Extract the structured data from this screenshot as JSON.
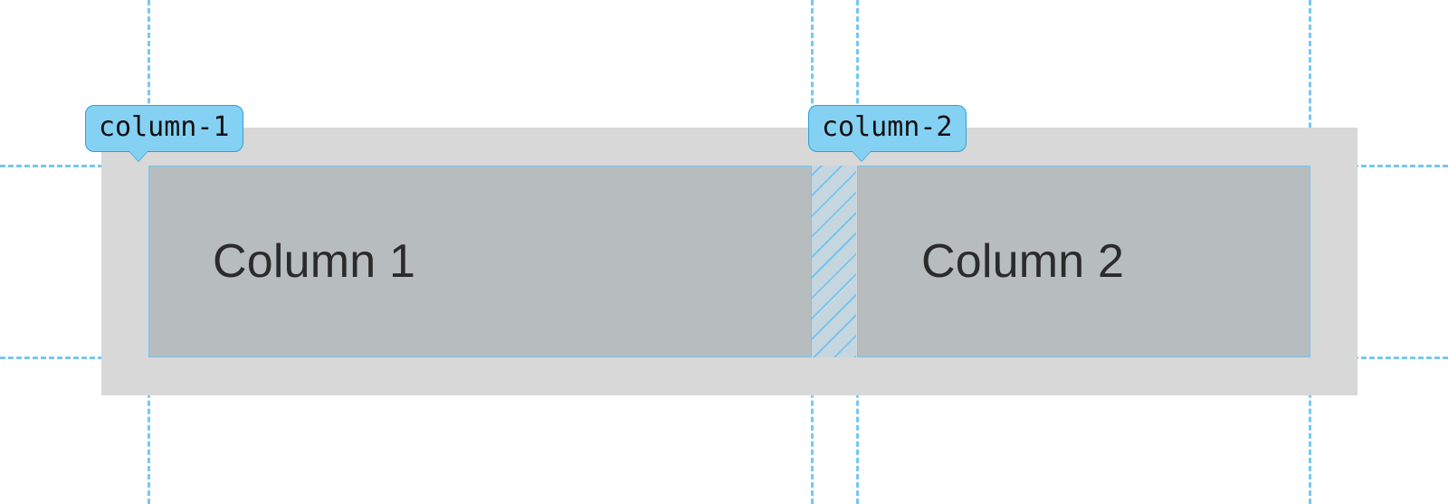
{
  "labels": {
    "col1_line_name": "column-1",
    "col2_line_name": "column-2"
  },
  "columns": {
    "col1_text": "Column 1",
    "col2_text": "Column 2"
  },
  "colors": {
    "guide_dash": "#77c8f0",
    "badge_fill": "#85d1f3",
    "badge_border": "#309fd6",
    "container_bg": "#d8d8d8",
    "cell_bg": "#b7bcbf"
  }
}
